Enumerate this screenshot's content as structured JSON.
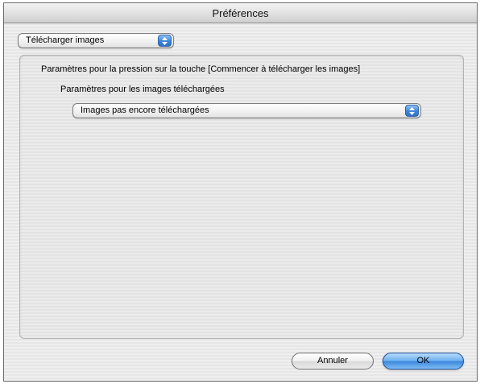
{
  "window": {
    "title": "Préférences"
  },
  "category_popup": {
    "selected": "Télécharger images"
  },
  "settings_group": {
    "heading": "Paramètres pour la pression sur la touche [Commencer à télécharger les images]",
    "subheading": "Paramètres pour les images téléchargées",
    "images_popup": {
      "selected": "Images pas encore téléchargées"
    }
  },
  "buttons": {
    "cancel_label": "Annuler",
    "ok_label": "OK"
  },
  "colors": {
    "accent": "#3c86dc",
    "window_background": "#ececec"
  },
  "icons": {
    "popup_arrows": "up-down-arrows-icon"
  }
}
